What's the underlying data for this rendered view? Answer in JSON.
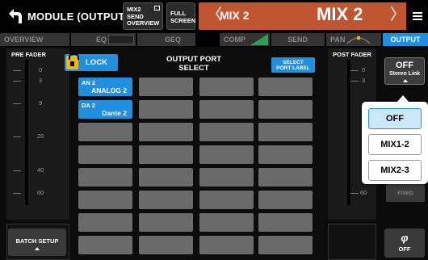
{
  "colors": {
    "accent": "#1f8fde",
    "channel_bar": "#c05532",
    "lock_yellow": "#f0b41c",
    "empty_cell": "#6a6a6a"
  },
  "header": {
    "back_icon": "back-arrow-icon",
    "title": "MODULE (OUTPUT)",
    "send_overview": {
      "line1": "MIX2",
      "line2": "SEND",
      "line3": "OVERVIEW"
    },
    "full_screen": {
      "line1": "FULL",
      "line2": "SCREEN"
    },
    "channel_prev_glyph": "〈",
    "channel_small": "MIX 2",
    "channel_big": "MIX 2",
    "channel_next_glyph": "〉",
    "menu_icon": "hamburger-menu-icon"
  },
  "tabs": {
    "overview": "OVERVIEW",
    "eq": "EQ",
    "geq": "GEQ",
    "comp": "COMP",
    "send": "SEND",
    "pan": "PAN",
    "output": "OUTPUT"
  },
  "pre_fader": {
    "title": "PRE FADER",
    "scale": [
      "0",
      "3",
      "9",
      "20",
      "40",
      "60"
    ]
  },
  "post_fader": {
    "title": "POST FADER",
    "scale": [
      "0",
      "3",
      "60"
    ]
  },
  "batch_setup": {
    "label": "BATCH SETUP"
  },
  "output_port": {
    "lock_label": "LOCK",
    "title_line1": "OUTPUT PORT",
    "title_line2": "SELECT",
    "select_port_label": {
      "line1": "SELECT",
      "line2": "PORT LABEL"
    },
    "cells": [
      {
        "top": "AN 2",
        "bottom": "ANALOG 2"
      },
      {
        "top": "DA 2",
        "bottom": "Dante 2"
      }
    ]
  },
  "stereo_link": {
    "value": "OFF",
    "label": "Stereo Link",
    "options": [
      "OFF",
      "MIX1-2",
      "MIX2-3"
    ],
    "selected": "OFF"
  },
  "fixed_label": "FIXED",
  "phase": {
    "symbol": "φ",
    "value": "OFF"
  }
}
